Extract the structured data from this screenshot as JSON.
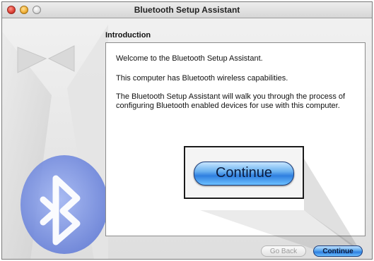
{
  "window": {
    "title": "Bluetooth Setup Assistant"
  },
  "section": {
    "heading": "Introduction"
  },
  "content": {
    "paragraphs": [
      "Welcome to the Bluetooth Setup Assistant.",
      "This computer has Bluetooth wireless capabilities.",
      "The Bluetooth Setup Assistant will walk you through the process of configuring Bluetooth enabled devices for use with this computer."
    ]
  },
  "callout": {
    "continue_label": "Continue"
  },
  "footer": {
    "go_back_label": "Go Back",
    "continue_label": "Continue"
  },
  "colors": {
    "accent": "#2f7fe0",
    "bluetooth_blue": "#5b76d6"
  },
  "icons": {
    "backdrop": "bluetooth-icon"
  }
}
